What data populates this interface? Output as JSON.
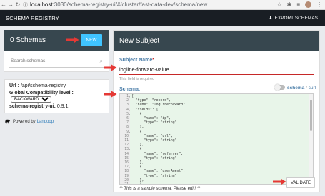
{
  "browser": {
    "url_host": "localhost",
    "url_path": ":3030/schema-registry-ui/#/cluster/fast-data-dev/schema/new"
  },
  "appbar": {
    "title": "SCHEMA REGISTRY",
    "export_label": "EXPORT SCHEMAS"
  },
  "left": {
    "schemas_title": "0 Schemas",
    "new_button": "NEW",
    "search_placeholder": "Search schemas"
  },
  "info": {
    "url_label": "Url :",
    "url_value": "/api/schema-registry",
    "compat_label": "Global Compatibility level :",
    "compat_value": "BACKWARD",
    "version_label": "schema-registry-ui:",
    "version_value": "0.9.1"
  },
  "powered": {
    "text": "Powered by",
    "link": "Landoop"
  },
  "form": {
    "title": "New Subject",
    "subject_label": "Subject Name",
    "required_mark": "*",
    "subject_value": "logline-forward-value",
    "field_required": "This field is required",
    "schema_label": "Schema:",
    "toggle_left": "schema",
    "toggle_sep": " / ",
    "toggle_right": "curl",
    "sample_note": "** This is a sample schema. Please edit! **",
    "validate_button": "VALIDATE"
  },
  "editor_lines": [
    {
      "n": "1",
      "fold": true,
      "text": "{"
    },
    {
      "n": "2",
      "fold": false,
      "text": "  \"type\": \"record\","
    },
    {
      "n": "3",
      "fold": false,
      "text": "  \"name\": \"logLineForward\","
    },
    {
      "n": "4",
      "fold": true,
      "text": "  \"fields\": ["
    },
    {
      "n": "5",
      "fold": true,
      "text": "    {"
    },
    {
      "n": "6",
      "fold": false,
      "text": "      \"name\": \"ip\","
    },
    {
      "n": "7",
      "fold": false,
      "text": "      \"type\": \"string\""
    },
    {
      "n": "8",
      "fold": false,
      "text": "    },"
    },
    {
      "n": "9",
      "fold": true,
      "text": "    {"
    },
    {
      "n": "10",
      "fold": false,
      "text": "      \"name\": \"url\","
    },
    {
      "n": "11",
      "fold": false,
      "text": "      \"type\": \"string\""
    },
    {
      "n": "12",
      "fold": false,
      "text": "    },"
    },
    {
      "n": "13",
      "fold": true,
      "text": "    {"
    },
    {
      "n": "14",
      "fold": false,
      "text": "      \"name\": \"referrer\","
    },
    {
      "n": "15",
      "fold": false,
      "text": "      \"type\": \"string\""
    },
    {
      "n": "16",
      "fold": false,
      "text": "    },"
    },
    {
      "n": "17",
      "fold": true,
      "text": "    {"
    },
    {
      "n": "18",
      "fold": false,
      "text": "      \"name\": \"userAgent\","
    },
    {
      "n": "19",
      "fold": false,
      "text": "      \"type\": \"string\""
    },
    {
      "n": "20",
      "fold": false,
      "text": "    },"
    },
    {
      "n": "21",
      "fold": true,
      "text": "    {"
    }
  ],
  "colors": {
    "appbar": "#191e24",
    "card_header": "#37474f",
    "new_button": "#40c4ff",
    "editor_bg": "#e8f5e9",
    "arrow": "#e53935",
    "label": "#4a7da8"
  }
}
